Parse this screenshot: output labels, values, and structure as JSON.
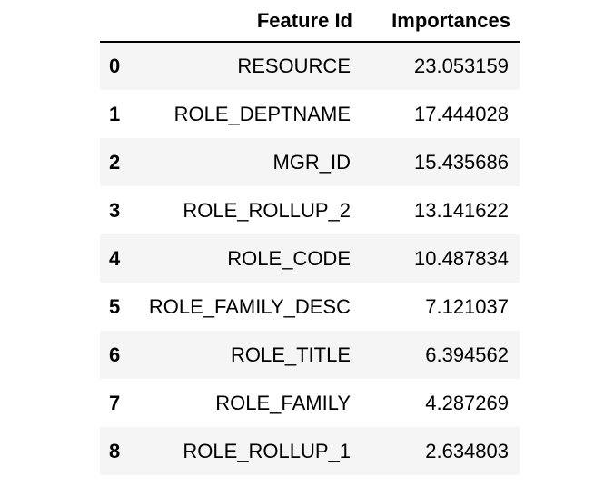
{
  "table": {
    "columns": [
      "Feature Id",
      "Importances"
    ],
    "rows": [
      {
        "index": "0",
        "feature_id": "RESOURCE",
        "importance": "23.053159"
      },
      {
        "index": "1",
        "feature_id": "ROLE_DEPTNAME",
        "importance": "17.444028"
      },
      {
        "index": "2",
        "feature_id": "MGR_ID",
        "importance": "15.435686"
      },
      {
        "index": "3",
        "feature_id": "ROLE_ROLLUP_2",
        "importance": "13.141622"
      },
      {
        "index": "4",
        "feature_id": "ROLE_CODE",
        "importance": "10.487834"
      },
      {
        "index": "5",
        "feature_id": "ROLE_FAMILY_DESC",
        "importance": "7.121037"
      },
      {
        "index": "6",
        "feature_id": "ROLE_TITLE",
        "importance": "6.394562"
      },
      {
        "index": "7",
        "feature_id": "ROLE_FAMILY",
        "importance": "4.287269"
      },
      {
        "index": "8",
        "feature_id": "ROLE_ROLLUP_1",
        "importance": "2.634803"
      }
    ]
  }
}
